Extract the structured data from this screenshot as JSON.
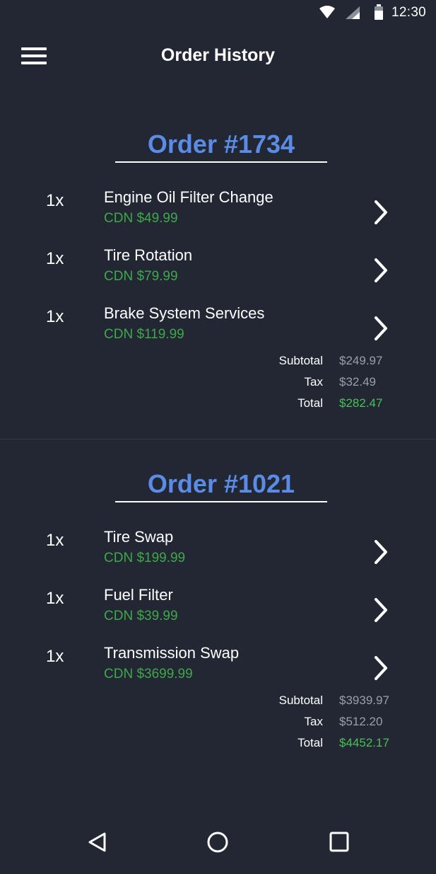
{
  "status_bar": {
    "time": "12:30",
    "icons": [
      "wifi-icon",
      "cellular-signal-icon",
      "battery-icon"
    ]
  },
  "app_bar": {
    "menu_icon": "hamburger-menu-icon",
    "title": "Order History"
  },
  "orders": [
    {
      "heading": "Order #1734",
      "items": [
        {
          "qty": "1x",
          "name": "Engine Oil Filter Change",
          "price": "CDN $49.99"
        },
        {
          "qty": "1x",
          "name": "Tire Rotation",
          "price": "CDN $79.99"
        },
        {
          "qty": "1x",
          "name": "Brake System Services",
          "price": "CDN $119.99"
        }
      ],
      "totals": {
        "subtotal_label": "Subtotal",
        "subtotal": "$249.97",
        "tax_label": "Tax",
        "tax": "$32.49",
        "total_label": "Total",
        "total": "$282.47"
      }
    },
    {
      "heading": "Order #1021",
      "items": [
        {
          "qty": "1x",
          "name": "Tire Swap",
          "price": "CDN $199.99"
        },
        {
          "qty": "1x",
          "name": "Fuel Filter",
          "price": "CDN $39.99"
        },
        {
          "qty": "1x",
          "name": "Transmission Swap",
          "price": "CDN $3699.99"
        }
      ],
      "totals": {
        "subtotal_label": "Subtotal",
        "subtotal": "$3939.97",
        "tax_label": "Tax",
        "tax": "$512.20",
        "total_label": "Total",
        "total": "$4452.17"
      }
    }
  ],
  "nav_bar": {
    "buttons": [
      "back-icon",
      "home-icon",
      "recent-apps-icon"
    ]
  },
  "colors": {
    "background": "#222733",
    "heading_accent": "#5a8ce6",
    "price_green": "#3fa84a",
    "total_green": "#49c156",
    "muted_value": "#9a9fa8"
  }
}
